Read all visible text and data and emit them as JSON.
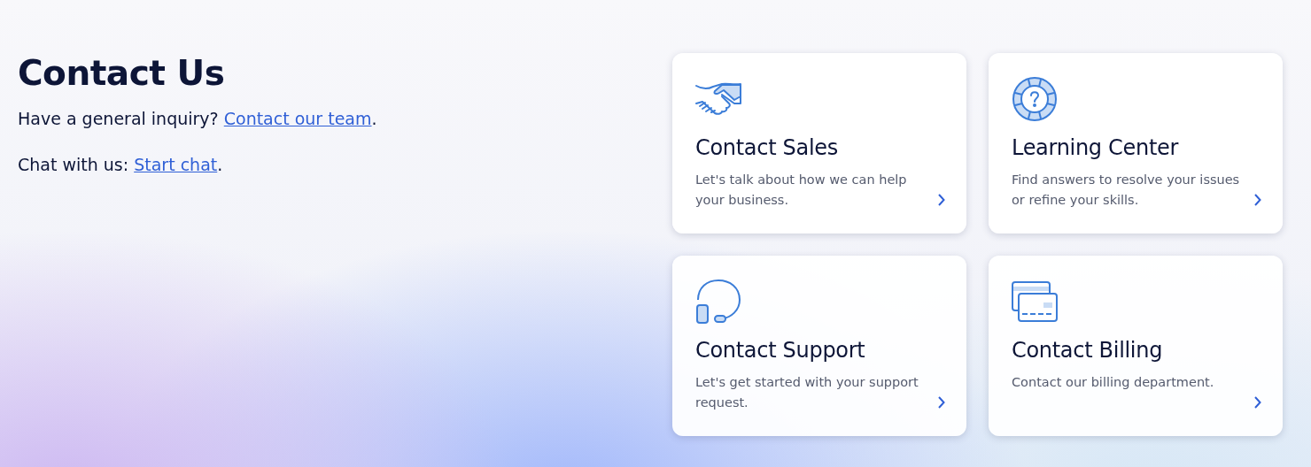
{
  "heading": "Contact Us",
  "lines": [
    {
      "text": "Have a general inquiry? ",
      "link": "Contact our team",
      "after": "."
    },
    {
      "text": "Chat with us: ",
      "link": "Start chat",
      "after": "."
    }
  ],
  "cards": [
    {
      "kind": "handshake",
      "title": "Contact Sales",
      "description": "Let's talk about how we can help your business."
    },
    {
      "kind": "lifebuoy",
      "title": "Learning Center",
      "description": "Find answers to resolve your issues or refine your skills."
    },
    {
      "kind": "headset",
      "title": "Contact Support",
      "description": "Let's get started with your support request."
    },
    {
      "kind": "cards",
      "title": "Contact Billing",
      "description": "Contact our billing department."
    }
  ]
}
